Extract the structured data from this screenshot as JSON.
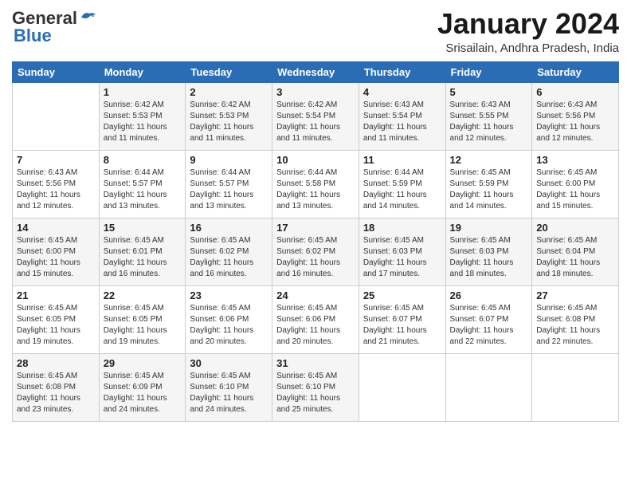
{
  "header": {
    "logo_general": "General",
    "logo_blue": "Blue",
    "month": "January 2024",
    "location": "Srisailain, Andhra Pradesh, India"
  },
  "days_of_week": [
    "Sunday",
    "Monday",
    "Tuesday",
    "Wednesday",
    "Thursday",
    "Friday",
    "Saturday"
  ],
  "weeks": [
    [
      {
        "num": "",
        "sunrise": "",
        "sunset": "",
        "daylight": ""
      },
      {
        "num": "1",
        "sunrise": "Sunrise: 6:42 AM",
        "sunset": "Sunset: 5:53 PM",
        "daylight": "Daylight: 11 hours and 11 minutes."
      },
      {
        "num": "2",
        "sunrise": "Sunrise: 6:42 AM",
        "sunset": "Sunset: 5:53 PM",
        "daylight": "Daylight: 11 hours and 11 minutes."
      },
      {
        "num": "3",
        "sunrise": "Sunrise: 6:42 AM",
        "sunset": "Sunset: 5:54 PM",
        "daylight": "Daylight: 11 hours and 11 minutes."
      },
      {
        "num": "4",
        "sunrise": "Sunrise: 6:43 AM",
        "sunset": "Sunset: 5:54 PM",
        "daylight": "Daylight: 11 hours and 11 minutes."
      },
      {
        "num": "5",
        "sunrise": "Sunrise: 6:43 AM",
        "sunset": "Sunset: 5:55 PM",
        "daylight": "Daylight: 11 hours and 12 minutes."
      },
      {
        "num": "6",
        "sunrise": "Sunrise: 6:43 AM",
        "sunset": "Sunset: 5:56 PM",
        "daylight": "Daylight: 11 hours and 12 minutes."
      }
    ],
    [
      {
        "num": "7",
        "sunrise": "Sunrise: 6:43 AM",
        "sunset": "Sunset: 5:56 PM",
        "daylight": "Daylight: 11 hours and 12 minutes."
      },
      {
        "num": "8",
        "sunrise": "Sunrise: 6:44 AM",
        "sunset": "Sunset: 5:57 PM",
        "daylight": "Daylight: 11 hours and 13 minutes."
      },
      {
        "num": "9",
        "sunrise": "Sunrise: 6:44 AM",
        "sunset": "Sunset: 5:57 PM",
        "daylight": "Daylight: 11 hours and 13 minutes."
      },
      {
        "num": "10",
        "sunrise": "Sunrise: 6:44 AM",
        "sunset": "Sunset: 5:58 PM",
        "daylight": "Daylight: 11 hours and 13 minutes."
      },
      {
        "num": "11",
        "sunrise": "Sunrise: 6:44 AM",
        "sunset": "Sunset: 5:59 PM",
        "daylight": "Daylight: 11 hours and 14 minutes."
      },
      {
        "num": "12",
        "sunrise": "Sunrise: 6:45 AM",
        "sunset": "Sunset: 5:59 PM",
        "daylight": "Daylight: 11 hours and 14 minutes."
      },
      {
        "num": "13",
        "sunrise": "Sunrise: 6:45 AM",
        "sunset": "Sunset: 6:00 PM",
        "daylight": "Daylight: 11 hours and 15 minutes."
      }
    ],
    [
      {
        "num": "14",
        "sunrise": "Sunrise: 6:45 AM",
        "sunset": "Sunset: 6:00 PM",
        "daylight": "Daylight: 11 hours and 15 minutes."
      },
      {
        "num": "15",
        "sunrise": "Sunrise: 6:45 AM",
        "sunset": "Sunset: 6:01 PM",
        "daylight": "Daylight: 11 hours and 16 minutes."
      },
      {
        "num": "16",
        "sunrise": "Sunrise: 6:45 AM",
        "sunset": "Sunset: 6:02 PM",
        "daylight": "Daylight: 11 hours and 16 minutes."
      },
      {
        "num": "17",
        "sunrise": "Sunrise: 6:45 AM",
        "sunset": "Sunset: 6:02 PM",
        "daylight": "Daylight: 11 hours and 16 minutes."
      },
      {
        "num": "18",
        "sunrise": "Sunrise: 6:45 AM",
        "sunset": "Sunset: 6:03 PM",
        "daylight": "Daylight: 11 hours and 17 minutes."
      },
      {
        "num": "19",
        "sunrise": "Sunrise: 6:45 AM",
        "sunset": "Sunset: 6:03 PM",
        "daylight": "Daylight: 11 hours and 18 minutes."
      },
      {
        "num": "20",
        "sunrise": "Sunrise: 6:45 AM",
        "sunset": "Sunset: 6:04 PM",
        "daylight": "Daylight: 11 hours and 18 minutes."
      }
    ],
    [
      {
        "num": "21",
        "sunrise": "Sunrise: 6:45 AM",
        "sunset": "Sunset: 6:05 PM",
        "daylight": "Daylight: 11 hours and 19 minutes."
      },
      {
        "num": "22",
        "sunrise": "Sunrise: 6:45 AM",
        "sunset": "Sunset: 6:05 PM",
        "daylight": "Daylight: 11 hours and 19 minutes."
      },
      {
        "num": "23",
        "sunrise": "Sunrise: 6:45 AM",
        "sunset": "Sunset: 6:06 PM",
        "daylight": "Daylight: 11 hours and 20 minutes."
      },
      {
        "num": "24",
        "sunrise": "Sunrise: 6:45 AM",
        "sunset": "Sunset: 6:06 PM",
        "daylight": "Daylight: 11 hours and 20 minutes."
      },
      {
        "num": "25",
        "sunrise": "Sunrise: 6:45 AM",
        "sunset": "Sunset: 6:07 PM",
        "daylight": "Daylight: 11 hours and 21 minutes."
      },
      {
        "num": "26",
        "sunrise": "Sunrise: 6:45 AM",
        "sunset": "Sunset: 6:07 PM",
        "daylight": "Daylight: 11 hours and 22 minutes."
      },
      {
        "num": "27",
        "sunrise": "Sunrise: 6:45 AM",
        "sunset": "Sunset: 6:08 PM",
        "daylight": "Daylight: 11 hours and 22 minutes."
      }
    ],
    [
      {
        "num": "28",
        "sunrise": "Sunrise: 6:45 AM",
        "sunset": "Sunset: 6:08 PM",
        "daylight": "Daylight: 11 hours and 23 minutes."
      },
      {
        "num": "29",
        "sunrise": "Sunrise: 6:45 AM",
        "sunset": "Sunset: 6:09 PM",
        "daylight": "Daylight: 11 hours and 24 minutes."
      },
      {
        "num": "30",
        "sunrise": "Sunrise: 6:45 AM",
        "sunset": "Sunset: 6:10 PM",
        "daylight": "Daylight: 11 hours and 24 minutes."
      },
      {
        "num": "31",
        "sunrise": "Sunrise: 6:45 AM",
        "sunset": "Sunset: 6:10 PM",
        "daylight": "Daylight: 11 hours and 25 minutes."
      },
      {
        "num": "",
        "sunrise": "",
        "sunset": "",
        "daylight": ""
      },
      {
        "num": "",
        "sunrise": "",
        "sunset": "",
        "daylight": ""
      },
      {
        "num": "",
        "sunrise": "",
        "sunset": "",
        "daylight": ""
      }
    ]
  ]
}
